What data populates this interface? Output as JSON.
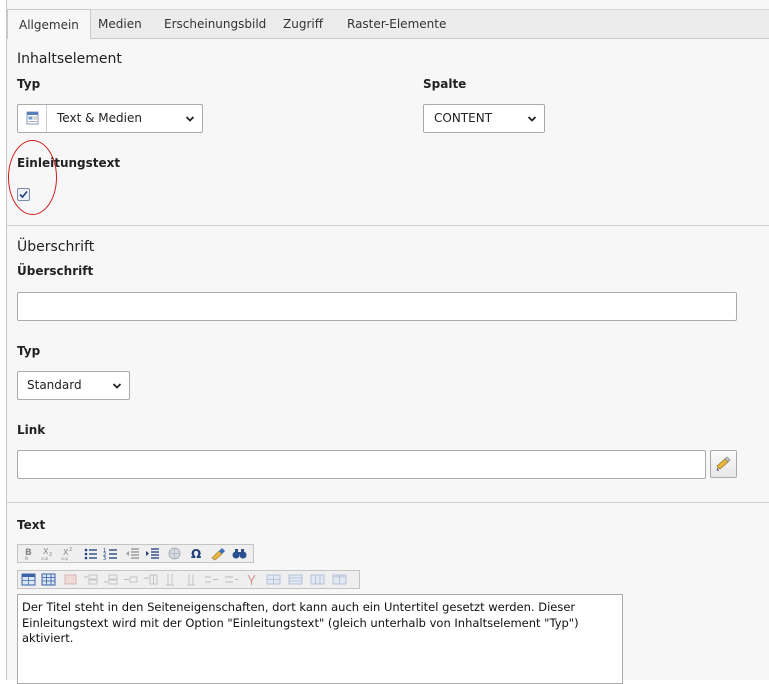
{
  "tabs": [
    {
      "label": "Allgemein",
      "active": true
    },
    {
      "label": "Medien",
      "active": false
    },
    {
      "label": "Erscheinungsbild",
      "active": false
    },
    {
      "label": "Zugriff",
      "active": false
    },
    {
      "label": "Raster-Elemente",
      "active": false
    }
  ],
  "content_element": {
    "section_title": "Inhaltselement",
    "type_label": "Typ",
    "type_value": "Text & Medien",
    "column_label": "Spalte",
    "column_value": "CONTENT",
    "intro_label": "Einleitungstext",
    "intro_checked": true
  },
  "header": {
    "section_title": "Überschrift",
    "header_label": "Überschrift",
    "header_value": "",
    "type_label": "Typ",
    "type_value": "Standard",
    "link_label": "Link",
    "link_value": ""
  },
  "text": {
    "label": "Text",
    "body": "Der Titel steht in den Seiteneigenschaften, dort kann auch ein Untertitel gesetzt werden. Dieser Einleitungstext wird mit der Option \"Einleitungstext\" (gleich unterhalb von Inhaltselement \"Typ\") aktiviert.",
    "toolbar1": [
      "bold",
      "subscript",
      "superscript",
      "unordered-list",
      "ordered-list",
      "outdent",
      "indent",
      "insert-link",
      "special-character",
      "remove-format",
      "find-replace"
    ],
    "toolbar2": [
      "table",
      "table-properties",
      "row-properties",
      "row-insert-before",
      "row-insert-after",
      "row-delete",
      "column-insert-before",
      "column-insert-after",
      "column-delete",
      "cell-split",
      "cell-merge",
      "table-toggle-borders",
      "table-restyle",
      "table-layout"
    ]
  },
  "colors": {
    "annotation": "#d02020"
  }
}
